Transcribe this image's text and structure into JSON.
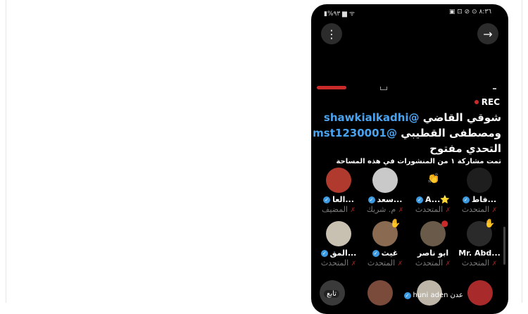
{
  "status": {
    "left": "▮%٩٣ ▆ ᯤ",
    "right": "▣ ⊡ ⊘ ⊙ ٨:٣٦"
  },
  "rec_label": "REC",
  "headline": {
    "line1_name": "شوقي القاضي",
    "line1_handle": "@shawkialkadhi",
    "line2_name": "ومصطفى القطيبي",
    "line2_handle": "@mst1230001",
    "line3": "التحدي مفتوح"
  },
  "shared_text": "تمت مشاركة ١ من المنشورات في هذه المساحة",
  "speakers_row1": [
    {
      "name": "فاط...",
      "role": "المتحدث",
      "avatar_color": "#1e1e1e"
    },
    {
      "name": "A...⭐",
      "role": "المتحدث",
      "avatar_color": "#000000"
    },
    {
      "name": "سعد...",
      "role": "م. شريك",
      "avatar_color": "#c9c9c9"
    },
    {
      "name": "العا...",
      "role": "المضيف",
      "avatar_color": "#b03a2e"
    }
  ],
  "speakers_row2": [
    {
      "name": "Mr. Abd...",
      "role": "المتحدث",
      "avatar_color": "#2a2a2a"
    },
    {
      "name": "ابو ناصر",
      "role": "المتحدث",
      "avatar_color": "#6a5a4a"
    },
    {
      "name": "غيث",
      "role": "المتحدث",
      "avatar_color": "#8a6a50"
    },
    {
      "name": "المق...",
      "role": "المتحدث",
      "avatar_color": "#c8c0b0"
    }
  ],
  "bottom": {
    "follow_label": "تابع",
    "handle_text": "huni aden",
    "arabic_tag": "عدن"
  },
  "colors": {
    "accent_blue": "#4aa3f0",
    "rec_red": "#c92b2b",
    "phone_bg": "#000000"
  },
  "icons": {
    "menu": "vertical-dots",
    "forward": "arrow-right"
  }
}
